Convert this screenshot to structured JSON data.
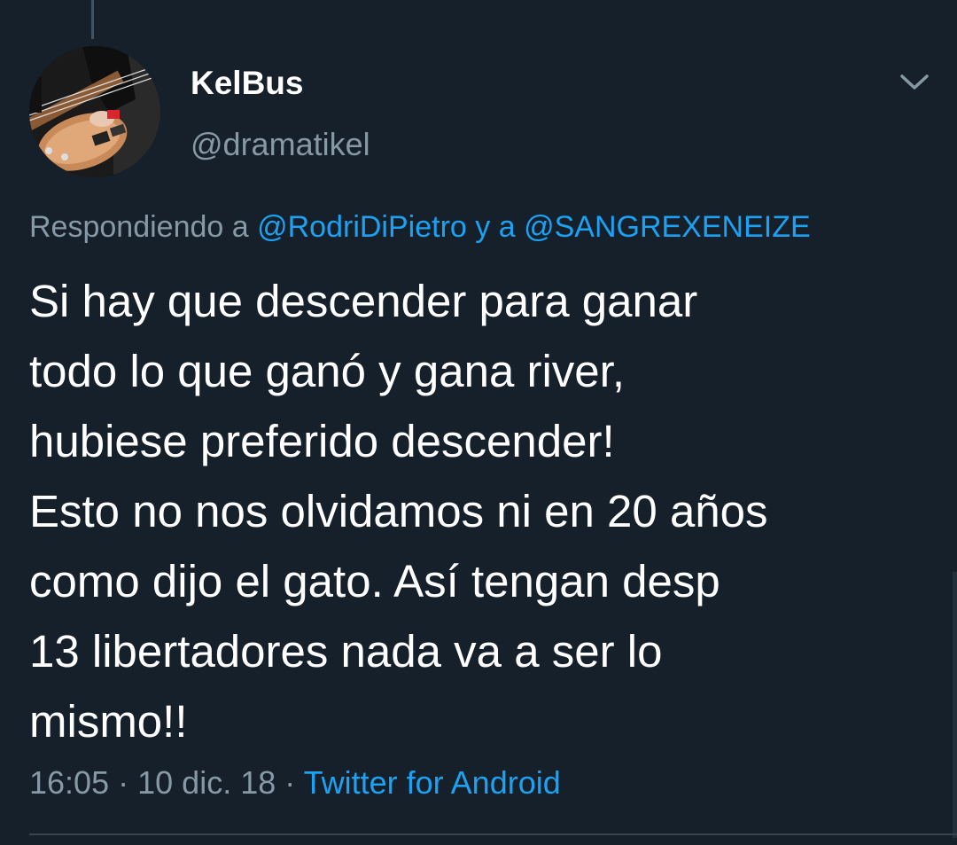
{
  "author": {
    "display_name": "KelBus",
    "handle": "@dramatikel"
  },
  "reply": {
    "prefix": "Respondiendo a",
    "mention1": "@RodriDiPietro",
    "joiner": "y a",
    "mention2": "@SANGREXENEIZE"
  },
  "tweet": {
    "lines": [
      "Si hay que descender para ganar",
      "todo lo que ganó y gana river,",
      "hubiese preferido descender!",
      "Esto no nos olvidamos ni en 20 años",
      "como dijo el gato. Así tengan desp",
      "13 libertadores nada va a ser lo",
      "mismo!!"
    ]
  },
  "meta": {
    "time": "16:05",
    "date": "10 dic. 18",
    "separator": "·",
    "source": "Twitter for Android"
  },
  "icons": {
    "menu": "chevron-down-icon"
  },
  "colors": {
    "background": "#15202b",
    "text": "#ffffff",
    "secondary": "#8899a6",
    "link": "#1da1f2",
    "divider": "#38444d"
  }
}
